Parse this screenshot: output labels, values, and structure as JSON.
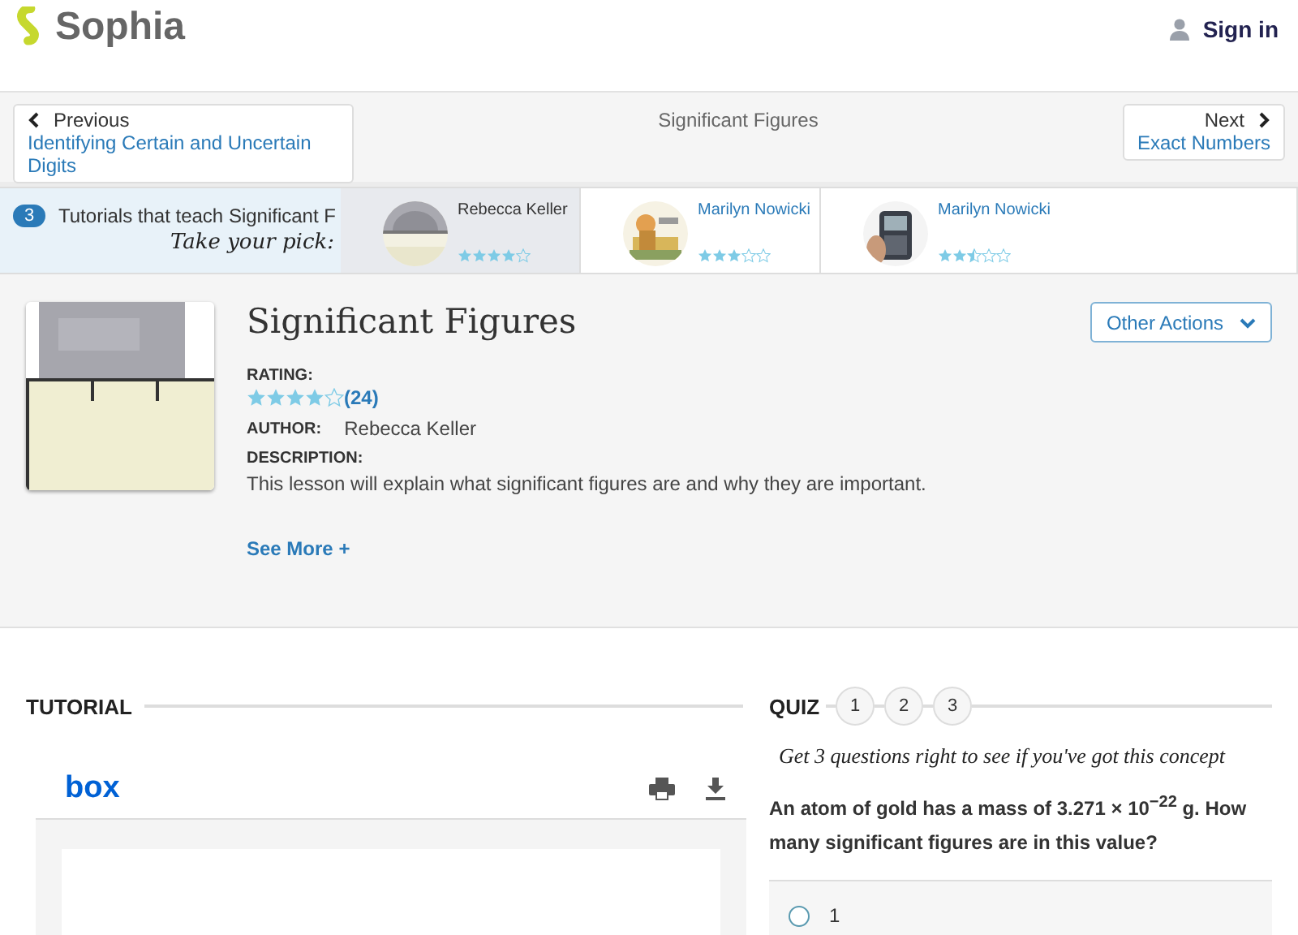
{
  "header": {
    "logo": "Sophia",
    "sign_in": "Sign in"
  },
  "nav": {
    "previous": {
      "label": "Previous",
      "title": "Identifying Certain and Uncertain Digits"
    },
    "current": "Significant Figures",
    "next": {
      "label": "Next",
      "title": "Exact Numbers"
    }
  },
  "tutorials": {
    "count": "3",
    "text": "Tutorials that teach Significant F",
    "pick": "Take your pick:",
    "items": [
      {
        "author": "Rebecca Keller",
        "stars": 4,
        "selected": true
      },
      {
        "author": "Marilyn Nowicki",
        "stars": 3,
        "selected": false
      },
      {
        "author": "Marilyn Nowicki",
        "stars": 2.5,
        "selected": false
      }
    ]
  },
  "lesson": {
    "title": "Significant Figures",
    "rating_label": "RATING:",
    "stars": 4,
    "rating_count": "(24)",
    "author_label": "AUTHOR:",
    "author": "Rebecca Keller",
    "description_label": "DESCRIPTION:",
    "description": "This lesson will explain what significant figures are and why they are important.",
    "see_more": "See More +",
    "other_actions": "Other Actions"
  },
  "tutorial": {
    "heading": "TUTORIAL",
    "viewer_logo": "box"
  },
  "quiz": {
    "heading": "QUIZ",
    "steps": [
      {
        "label": "1",
        "selected": false
      },
      {
        "label": "2",
        "selected": false
      },
      {
        "label": "3",
        "selected": false
      }
    ],
    "prompt": "Get 3 questions right to see if you've got this concept",
    "question": "An atom of gold has a mass of 3.271 × 10$^{−22}$ g. How many significant figures are in this value?",
    "choices": [
      {
        "label": "1",
        "selected": false
      }
    ]
  }
}
